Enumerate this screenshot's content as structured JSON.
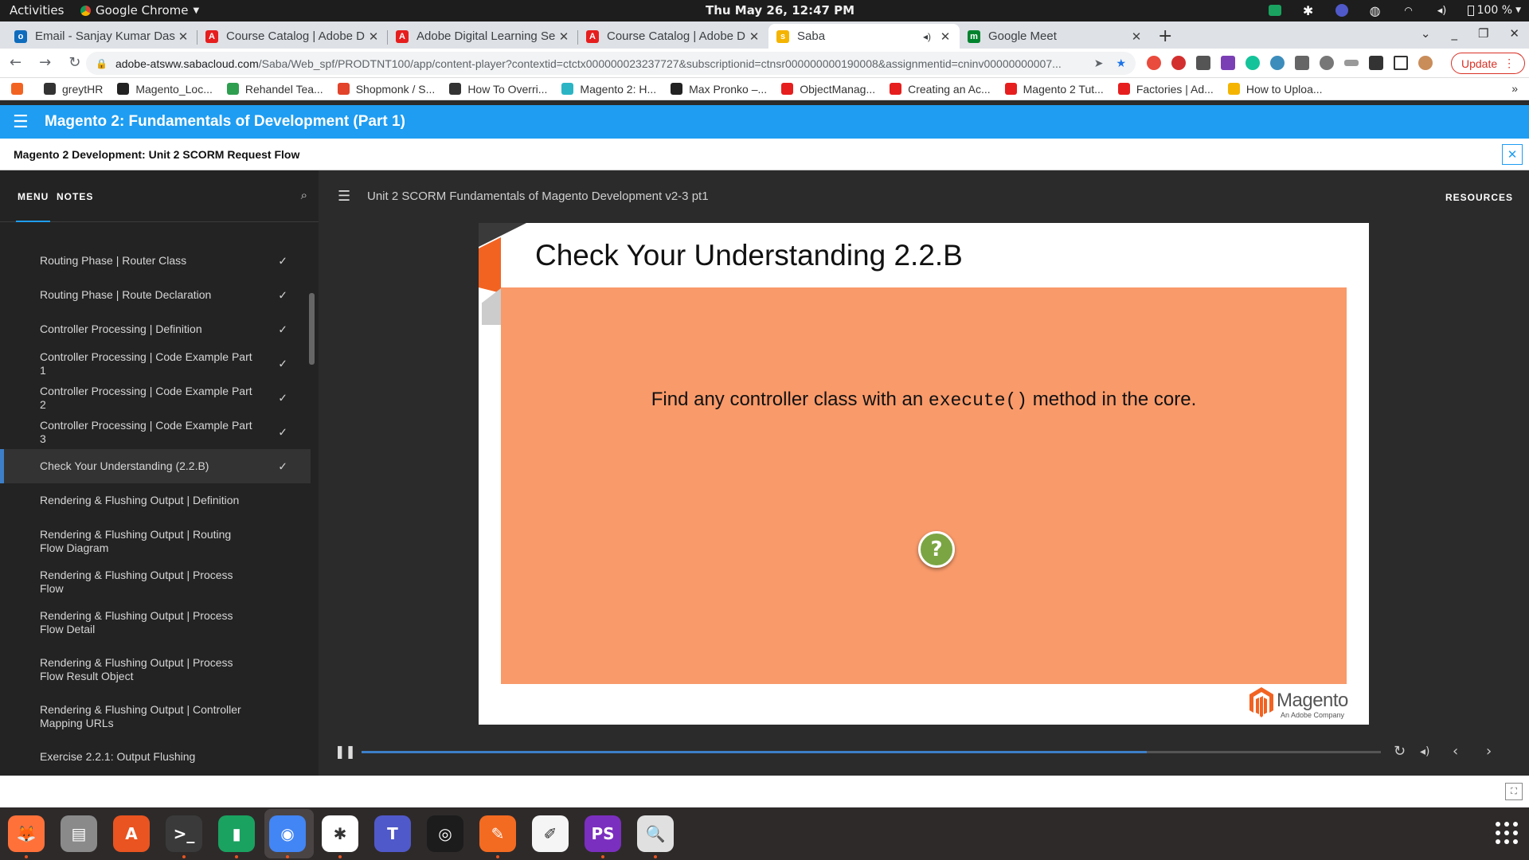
{
  "system_bar": {
    "activities": "Activities",
    "app_menu": "Google Chrome",
    "clock": "Thu May 26, 12:47 PM",
    "battery": "100 %"
  },
  "tabs": [
    {
      "label": "Email - Sanjay Kumar Das",
      "color": "#0f6cbd",
      "glyph": "o"
    },
    {
      "label": "Course Catalog | Adobe D",
      "color": "#e61e1e",
      "glyph": "A"
    },
    {
      "label": "Adobe Digital Learning Se",
      "color": "#e61e1e",
      "glyph": "A"
    },
    {
      "label": "Course Catalog | Adobe D",
      "color": "#e61e1e",
      "glyph": "A"
    },
    {
      "label": "Saba",
      "color": "#f4b400",
      "glyph": "s"
    },
    {
      "label": "Google Meet",
      "color": "#00832d",
      "glyph": "m"
    }
  ],
  "address_bar": {
    "host": "adobe-atsww.sabacloud.com",
    "path": "/Saba/Web_spf/PRODTNT100/app/content-player?contextid=ctctx000000023237727&subscriptionid=ctnsr000000000190008&assignmentid=cninv00000000007...",
    "update_label": "Update"
  },
  "bookmarks": [
    {
      "label": "greytHR",
      "color": "#333"
    },
    {
      "label": "Magento_Loc...",
      "color": "#222"
    },
    {
      "label": "Rehandel Tea...",
      "color": "#2e9e4f"
    },
    {
      "label": "Shopmonk / S...",
      "color": "#e2432a"
    },
    {
      "label": "How To Overri...",
      "color": "#333"
    },
    {
      "label": "Magento 2: H...",
      "color": "#2bb5c4"
    },
    {
      "label": "Max Pronko –...",
      "color": "#222"
    },
    {
      "label": "ObjectManag...",
      "color": "#e61e1e"
    },
    {
      "label": "Creating an Ac...",
      "color": "#e61e1e"
    },
    {
      "label": "Magento 2 Tut...",
      "color": "#e61e1e"
    },
    {
      "label": "Factories | Ad...",
      "color": "#e61e1e"
    },
    {
      "label": "How to Uploa...",
      "color": "#f4b400"
    }
  ],
  "course": {
    "title": "Magento 2: Fundamentals of Development (Part 1)",
    "unit": "Magento 2 Development: Unit 2 SCORM Request Flow"
  },
  "sidebar": {
    "tab_menu": "MENU",
    "tab_notes": "NOTES",
    "items": [
      {
        "label": "Routing Phase | Router Class",
        "done": true
      },
      {
        "label": "Routing Phase | Route Declaration",
        "done": true
      },
      {
        "label": "Controller Processing | Definition",
        "done": true
      },
      {
        "label": "Controller Processing | Code Example Part 1",
        "done": true
      },
      {
        "label": "Controller Processing | Code Example Part 2",
        "done": true
      },
      {
        "label": "Controller Processing | Code Example Part 3",
        "done": true
      },
      {
        "label": "Check Your Understanding (2.2.B)",
        "done": true,
        "active": true
      },
      {
        "label": "Rendering & Flushing Output | Definition",
        "done": false
      },
      {
        "label": "Rendering & Flushing Output | Routing Flow Diagram",
        "done": false
      },
      {
        "label": "Rendering & Flushing Output | Process Flow",
        "done": false
      },
      {
        "label": "Rendering & Flushing Output | Process Flow Detail",
        "done": false
      },
      {
        "label": "Rendering & Flushing Output | Process Flow Result Object",
        "done": false
      },
      {
        "label": "Rendering & Flushing Output | Controller Mapping URLs",
        "done": false
      },
      {
        "label": "Exercise 2.2.1: Output Flushing",
        "done": false
      }
    ]
  },
  "player": {
    "title": "Unit 2 SCORM Fundamentals of Magento Development v2-3 pt1",
    "resources": "RESOURCES",
    "progress_fraction": 0.77
  },
  "slide": {
    "title": "Check Your Understanding 2.2.B",
    "prompt_before": "Find any controller class with an ",
    "prompt_code": "execute()",
    "prompt_after": " method in the core.",
    "question_mark": "?",
    "logo_word": "Magento",
    "logo_sub": "An Adobe Company",
    "box_color": "#f99a6a"
  },
  "dock": [
    {
      "name": "firefox-icon",
      "color": "#ff7139",
      "glyph": "🦊"
    },
    {
      "name": "files-icon",
      "color": "#8a8a8a",
      "glyph": "▤"
    },
    {
      "name": "software-center-icon",
      "color": "#e95420",
      "glyph": "A"
    },
    {
      "name": "terminal-icon",
      "color": "#3a3a3a",
      "glyph": ">_"
    },
    {
      "name": "google-chat-icon",
      "color": "#1aa260",
      "glyph": "▮"
    },
    {
      "name": "chrome-icon",
      "color": "#4285f4",
      "glyph": "◉"
    },
    {
      "name": "slack-icon",
      "color": "#ffffff",
      "glyph": "✱"
    },
    {
      "name": "teams-icon",
      "color": "#5059c9",
      "glyph": "T"
    },
    {
      "name": "camera-icon",
      "color": "#1c1c1c",
      "glyph": "◎"
    },
    {
      "name": "pen-icon",
      "color": "#f36b21",
      "glyph": "✎"
    },
    {
      "name": "text-editor-icon",
      "color": "#f5f5f5",
      "glyph": "✐"
    },
    {
      "name": "phpstorm-icon",
      "color": "#7b2fbe",
      "glyph": "PS"
    },
    {
      "name": "image-viewer-icon",
      "color": "#e0e0e0",
      "glyph": "🔍"
    }
  ]
}
